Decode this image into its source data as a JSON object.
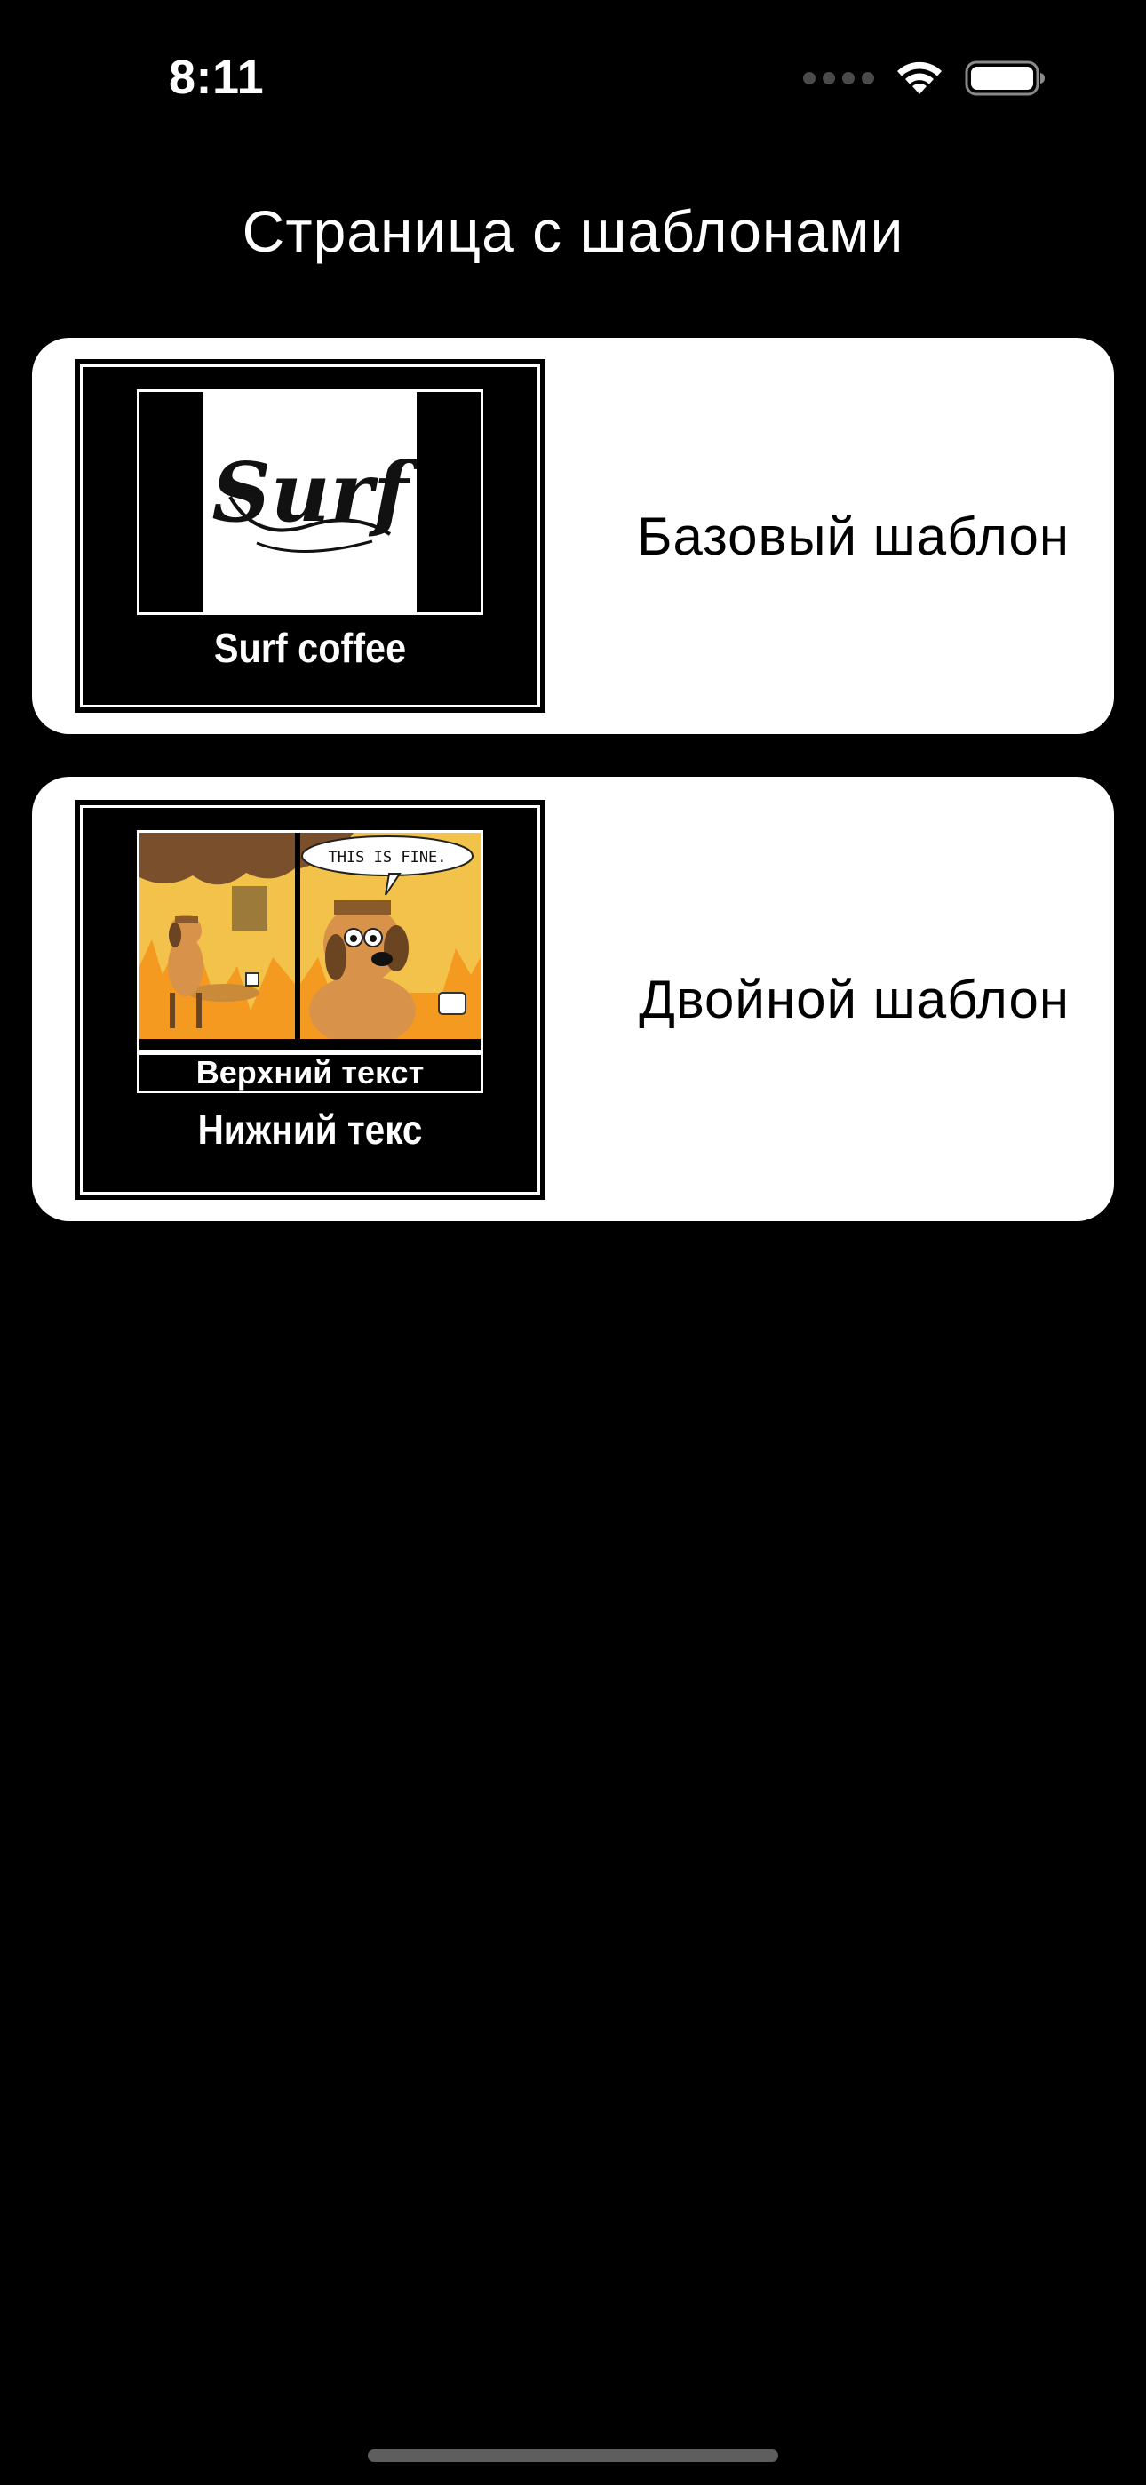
{
  "status_bar": {
    "time": "8:11",
    "icons": [
      "signal-dots-icon",
      "wifi-icon",
      "battery-icon"
    ]
  },
  "header": {
    "title": "Страница с шаблонами"
  },
  "templates": [
    {
      "label": "Базовый шаблон",
      "preview": {
        "logo_text": "Surf",
        "caption": "Surf coffee"
      }
    },
    {
      "label": "Двойной шаблон",
      "preview": {
        "speech_bubble": "THIS IS FINE.",
        "top_text": "Верхний текст",
        "bottom_text": "Нижний текс"
      }
    }
  ],
  "colors": {
    "background": "#000000",
    "card": "#ffffff",
    "text_on_dark": "#ffffff",
    "text_on_card": "#000000",
    "fire": "#f4b23c",
    "dog": "#d9924a"
  }
}
